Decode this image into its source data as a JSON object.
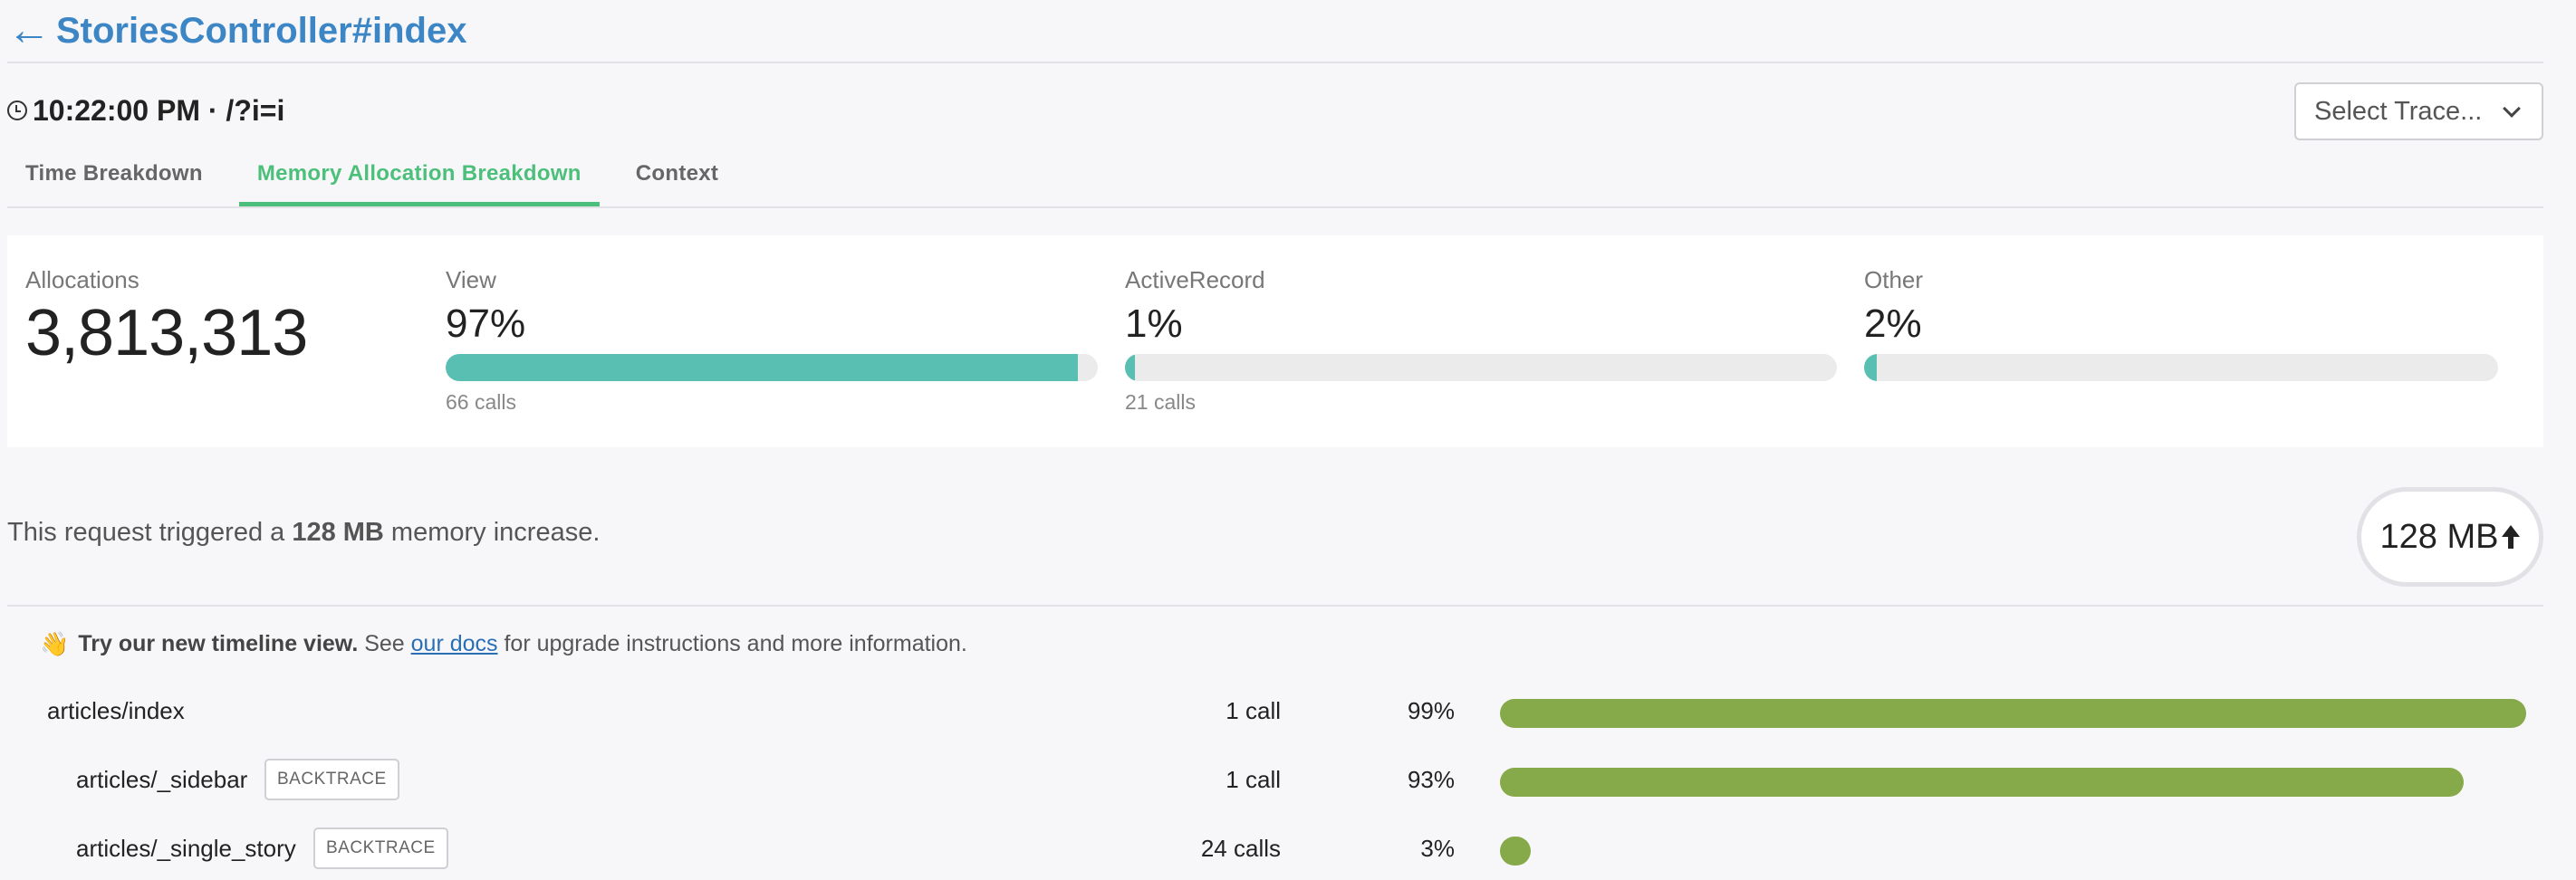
{
  "header": {
    "back_glyph": "←",
    "title": "StoriesController#index"
  },
  "meta": {
    "text": "10:22:00 PM · /?i=i",
    "icon": "clock-icon"
  },
  "select_trace": {
    "label": "Select Trace..."
  },
  "tabs": [
    {
      "label": "Time Breakdown",
      "active": false
    },
    {
      "label": "Memory Allocation Breakdown",
      "active": true
    },
    {
      "label": "Context",
      "active": false
    }
  ],
  "summary": {
    "allocations_label": "Allocations",
    "allocations_value": "3,813,313",
    "categories": [
      {
        "label": "View",
        "percent_text": "97%",
        "fill_percent": 97,
        "calls": "66 calls"
      },
      {
        "label": "ActiveRecord",
        "percent_text": "1%",
        "fill_percent": 1,
        "calls": "21 calls"
      },
      {
        "label": "Other",
        "percent_text": "2%",
        "fill_percent": 2,
        "calls": ""
      }
    ]
  },
  "memory": {
    "prefix": "This request triggered a ",
    "amount": "128 MB",
    "suffix": " memory increase.",
    "badge": "128 MB"
  },
  "notice": {
    "emoji": "👋",
    "bold": "Try our new timeline view.",
    "see": " See ",
    "link": "our docs",
    "rest": " for upgrade instructions and more information."
  },
  "breakdown": {
    "backtrace_label": "BACKTRACE",
    "rows": [
      {
        "name": "articles/index",
        "calls": "1 call",
        "percent_text": "99%",
        "percent": 99
      },
      {
        "name": "articles/_sidebar",
        "calls": "1 call",
        "percent_text": "93%",
        "percent": 93
      },
      {
        "name": "articles/_single_story",
        "calls": "24 calls",
        "percent_text": "3%",
        "percent": 3
      }
    ]
  },
  "colors": {
    "accent": "#4cc07a",
    "link": "#3d86c6",
    "bar_teal": "#5abfb3",
    "bar_green": "#86a94a"
  }
}
